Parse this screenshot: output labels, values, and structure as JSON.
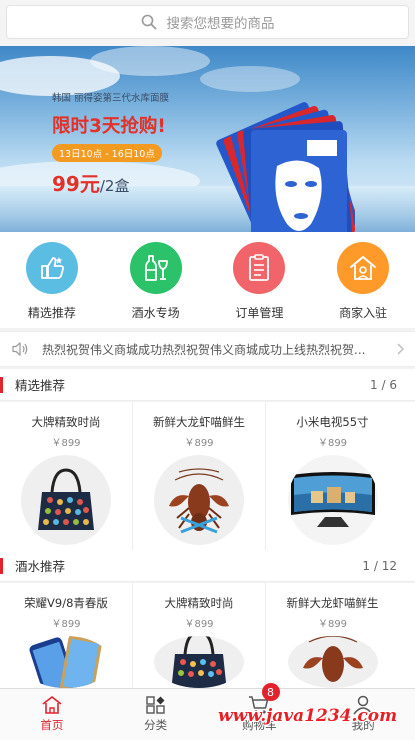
{
  "search": {
    "placeholder": "搜索您想要的商品"
  },
  "banner": {
    "brand_line": "韩国 丽得姿第三代水库面膜",
    "headline": "限时3天抢购!",
    "dates": "13日10点 - 16日10点",
    "price": "99元",
    "unit": "/2盒",
    "slide_count": 4,
    "active_slide": 0
  },
  "quicknav": [
    {
      "label": "精选推荐",
      "icon": "thumb-up-icon",
      "color": "#5cbde2"
    },
    {
      "label": "酒水专场",
      "icon": "wine-icon",
      "color": "#2bc26a"
    },
    {
      "label": "订单管理",
      "icon": "order-list-icon",
      "color": "#f16469"
    },
    {
      "label": "商家入驻",
      "icon": "shop-icon",
      "color": "#fd9a2a"
    }
  ],
  "notice": {
    "text": "热烈祝贺伟义商城成功热烈祝贺伟义商城成功上线热烈祝贺..."
  },
  "sections": [
    {
      "title": "精选推荐",
      "page": "1 / 6",
      "products": [
        {
          "name": "大牌精致时尚",
          "price": "￥899",
          "image": "handbag"
        },
        {
          "name": "新鲜大龙虾喵鲜生",
          "price": "￥899",
          "image": "lobster"
        },
        {
          "name": "小米电视55寸",
          "price": "￥899",
          "image": "tv"
        }
      ]
    },
    {
      "title": "酒水推荐",
      "page": "1 / 12",
      "products": [
        {
          "name": "荣耀V9/8青春版",
          "price": "￥899",
          "image": "phone"
        },
        {
          "name": "大牌精致时尚",
          "price": "￥899",
          "image": "handbag"
        },
        {
          "name": "新鲜大龙虾喵鲜生",
          "price": "￥899",
          "image": "lobster"
        }
      ]
    }
  ],
  "tabbar": [
    {
      "label": "首页",
      "icon": "home-icon",
      "active": true
    },
    {
      "label": "分类",
      "icon": "category-icon",
      "active": false
    },
    {
      "label": "购物车",
      "icon": "cart-icon",
      "active": false,
      "badge": "8"
    },
    {
      "label": "我的",
      "icon": "user-icon",
      "active": false
    }
  ],
  "watermark": "www.java1234.com",
  "colors": {
    "accent": "#e3232c",
    "price_red": "#e23128"
  }
}
